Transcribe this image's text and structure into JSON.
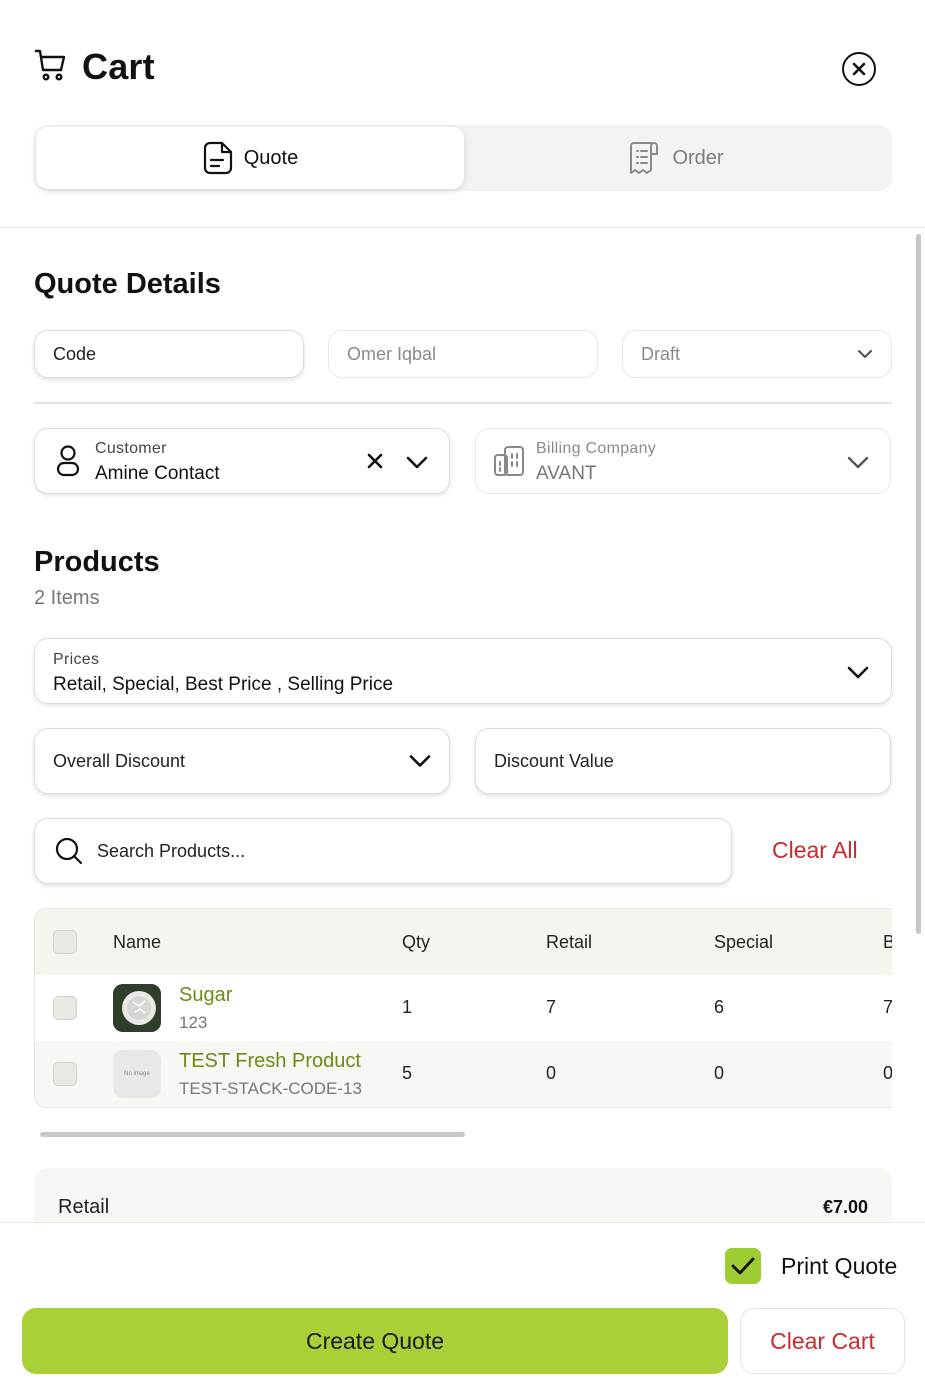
{
  "header": {
    "title": "Cart",
    "icons": {
      "cart": "cart-icon",
      "close": "close-icon"
    }
  },
  "tabs": [
    {
      "label": "Quote",
      "icon": "document-icon",
      "active": true
    },
    {
      "label": "Order",
      "icon": "receipt-icon",
      "active": false
    }
  ],
  "quote_details": {
    "title": "Quote Details",
    "code_placeholder": "Code",
    "owner": "Omer Iqbal",
    "status": "Draft"
  },
  "customer": {
    "label": "Customer",
    "value": "Amine Contact"
  },
  "billing": {
    "label": "Billing Company",
    "value": "AVANT"
  },
  "products": {
    "title": "Products",
    "count_text": "2 Items",
    "prices_label": "Prices",
    "prices_value": "Retail, Special, Best Price , Selling Price",
    "discount_placeholder": "Overall Discount",
    "discount_value_placeholder": "Discount Value",
    "search_placeholder": "Search Products...",
    "clear_all": "Clear All"
  },
  "table": {
    "headers": [
      "Name",
      "Qty",
      "Retail",
      "Special",
      "B"
    ],
    "rows": [
      {
        "name": "Sugar",
        "sku": "123",
        "qty": "1",
        "retail": "7",
        "special": "6",
        "best": "7",
        "thumb_text": ""
      },
      {
        "name": "TEST Fresh Product",
        "sku": "TEST-STACK-CODE-13",
        "qty": "5",
        "retail": "0",
        "special": "0",
        "best": "0",
        "thumb_text": "No image"
      }
    ]
  },
  "summary": {
    "label": "Retail",
    "value": "€7.00"
  },
  "footer": {
    "print_label": "Print Quote",
    "print_checked": true,
    "create_label": "Create Quote",
    "clear_cart_label": "Clear Cart"
  },
  "colors": {
    "accent": "#a9d037",
    "danger": "#cc2a2a",
    "product_link": "#6c8b16"
  }
}
